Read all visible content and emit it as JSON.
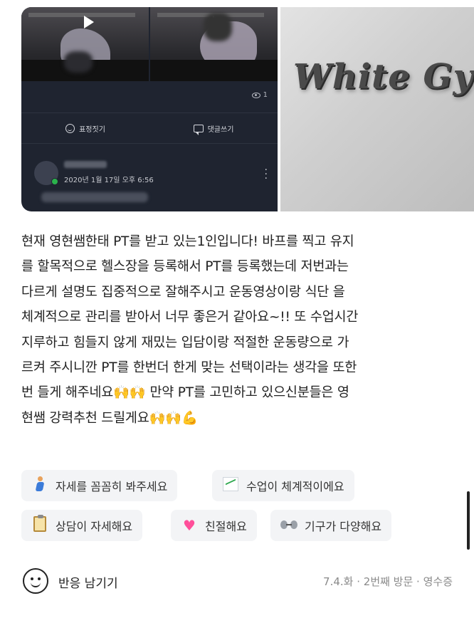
{
  "photos": {
    "left": {
      "views": "1",
      "actions": {
        "emotion_label": "표정짓기",
        "comment_label": "댓글쓰기"
      },
      "comment": {
        "timestamp": "2020년 1월 17일 오후 6:56"
      }
    },
    "right": {
      "sign_text": "White Gy"
    }
  },
  "review": {
    "lines": [
      "현재 영현쌤한태 PT를 받고 있는1인입니다! 바프를 찍고 유지",
      "를 할목적으로 헬스장을 등록해서 PT를 등록했는데 저번과는",
      "다르게 설명도 집중적으로 잘해주시고 운동영상이랑 식단 을",
      "체계적으로 관리를 받아서 너무 좋은거 같아요~!! 또 수업시간",
      "지루하고 힘들지 않게 재밌는 입담이랑 적절한 운동량으로 가",
      "르켜 주시니깐 PT를 한번더 한게 맞는 선택이라는 생각을 또한",
      "번 들게 해주네요🙌🙌 만약 PT를 고민하고 있으신분들은 영",
      "현쌤 강력추천 드릴게요🙌🙌💪"
    ]
  },
  "keywords": [
    {
      "label": "자세를 꼼꼼히 봐주세요",
      "icon": "runner-icon"
    },
    {
      "label": "수업이 체계적이에요",
      "icon": "chart-icon"
    },
    {
      "label": "상담이 자세해요",
      "icon": "clipboard-icon"
    },
    {
      "label": "친절해요",
      "icon": "heart-icon"
    },
    {
      "label": "기구가 다양해요",
      "icon": "dumbbell-icon"
    }
  ],
  "footer": {
    "reaction_label": "반응 남기기",
    "meta": "7.4.화 · 2번째 방문 · 영수증"
  }
}
